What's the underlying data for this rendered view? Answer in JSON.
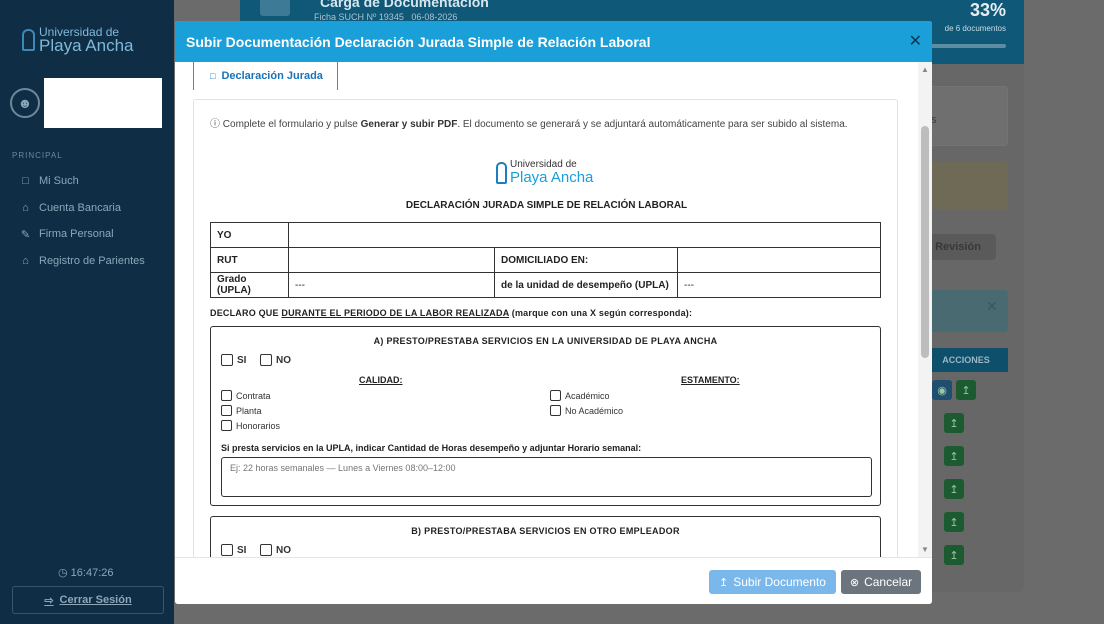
{
  "app": {
    "logo_line1": "Universidad de",
    "logo_line2": "Playa Ancha",
    "section_label": "PRINCIPAL",
    "menu": [
      {
        "label": "Mi Such",
        "icon": "file-icon"
      },
      {
        "label": "Cuenta Bancaria",
        "icon": "bank-icon"
      },
      {
        "label": "Firma Personal",
        "icon": "edit-icon"
      },
      {
        "label": "Registro de Parientes",
        "icon": "bank-icon"
      }
    ],
    "clock": "16:47:26",
    "logout_label": "Cerrar Sesión"
  },
  "background": {
    "header_title": "Carga de Documentación",
    "ficha": "Ficha SUCH Nº 19345",
    "date": "06-08-2026",
    "progress_percent": "33%",
    "progress_label": "de 6 documentos",
    "revision_label": "Revisión",
    "actions_header": "ACCIONES",
    "partial_text": "s"
  },
  "modal": {
    "title": "Subir Documentación Declaración Jurada Simple de Relación Laboral",
    "tab_label": "Declaración Jurada",
    "info_prefix": "Complete el formulario y pulse ",
    "info_bold": "Generar y subir PDF",
    "info_suffix": ". El documento se generará y se adjuntará automáticamente para ser subido al sistema.",
    "doc_logo_line1": "Universidad de",
    "doc_logo_line2": "Playa Ancha",
    "doc_title": "DECLARACIÓN JURADA SIMPLE DE RELACIÓN LABORAL",
    "form": {
      "yo_label": "YO",
      "rut_label": "RUT",
      "domicilio_label": "DOMICILIADO EN:",
      "grado_label": "Grado (UPLA)",
      "grado_value": "---",
      "unidad_label": "de la unidad de desempeño (UPLA)",
      "unidad_value": "---"
    },
    "declaro_prefix": "DECLARO QUE ",
    "declaro_underline": "DURANTE EL PERIODO DE LA LABOR REALIZADA",
    "declaro_suffix": " (marque con una X según corresponda):",
    "section_a": {
      "title": "A) PRESTO/PRESTABA SERVICIOS EN LA UNIVERSIDAD DE PLAYA ANCHA",
      "si": "SI",
      "no": "NO",
      "calidad_header": "CALIDAD:",
      "estamento_header": "ESTAMENTO:",
      "calidad_options": [
        "Contrata",
        "Planta",
        "Honorarios"
      ],
      "estamento_options": [
        "Académico",
        "No Académico"
      ],
      "hours_label": "Si presta servicios en la UPLA, indicar Cantidad de Horas desempeño y adjuntar Horario semanal:",
      "hours_placeholder": "Ej: 22 horas semanales — Lunes a Viernes 08:00–12:00"
    },
    "section_b": {
      "title": "B) PRESTO/PRESTABA SERVICIOS EN OTRO EMPLEADOR",
      "si": "SI",
      "no": "NO"
    },
    "submit_label": "Subir Documento",
    "cancel_label": "Cancelar"
  }
}
